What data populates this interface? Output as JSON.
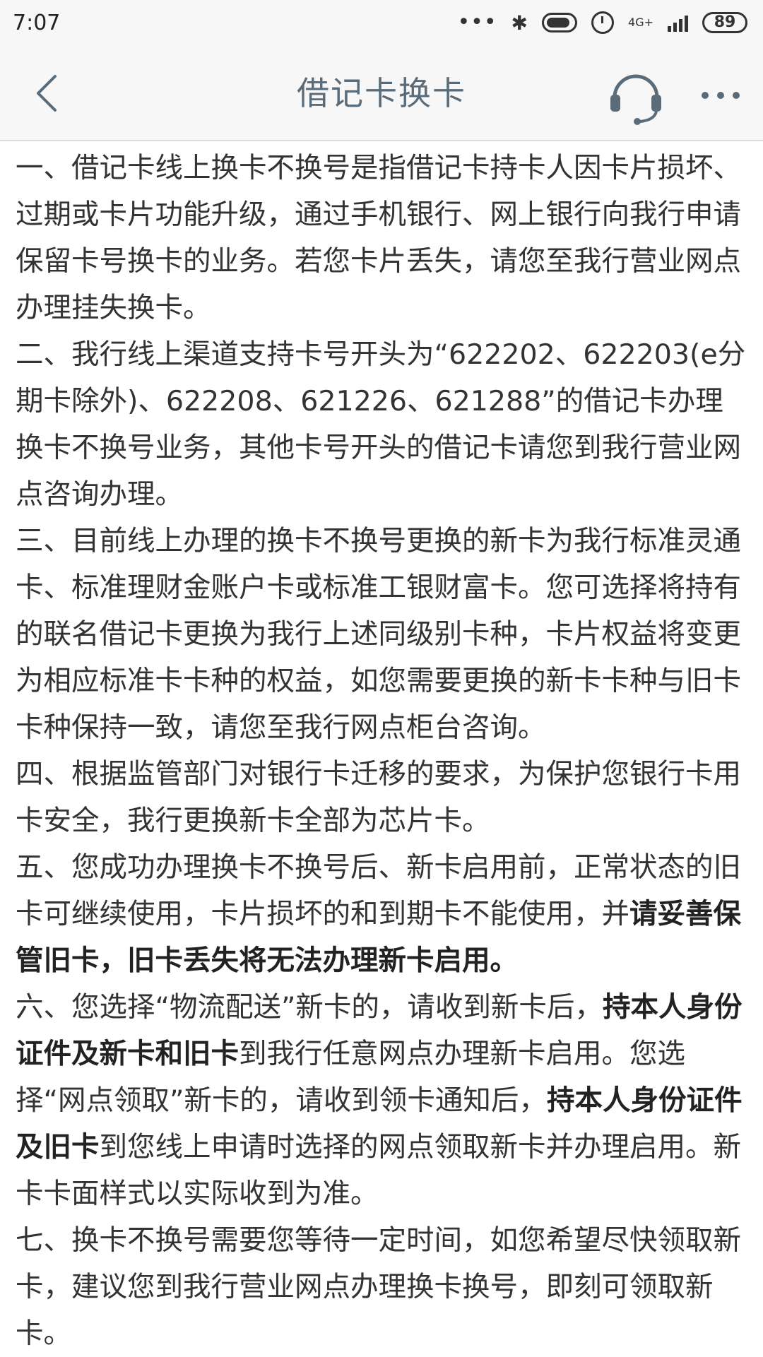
{
  "status_bar": {
    "time": "7:07",
    "dots": "•••",
    "network": "4G+",
    "battery": "89"
  },
  "nav": {
    "title": "借记卡换卡",
    "back_icon": "chevron-left-icon",
    "support_icon": "headset-icon",
    "more_icon": "more-dots-icon",
    "accent_color": "#5a6b79"
  },
  "paragraphs": [
    {
      "segments": [
        {
          "text": "一、借记卡线上换卡不换号是指借记卡持卡人因卡片损坏、过期或卡片功能升级，通过手机银行、网上银行向我行申请保留卡号换卡的业务。若您卡片丢失，请您至我行营业网点办理挂失换卡。",
          "bold": false
        }
      ]
    },
    {
      "segments": [
        {
          "text": "二、我行线上渠道支持卡号开头为“622202、622203(e分期卡除外)、622208、621226、621288”的借记卡办理换卡不换号业务，其他卡号开头的借记卡请您到我行营业网点咨询办理。",
          "bold": false
        }
      ]
    },
    {
      "segments": [
        {
          "text": "三、目前线上办理的换卡不换号更换的新卡为我行标准灵通卡、标准理财金账户卡或标准工银财富卡。您可选择将持有的联名借记卡更换为我行上述同级别卡种，卡片权益将变更为相应标准卡卡种的权益，如您需要更换的新卡卡种与旧卡卡种保持一致，请您至我行网点柜台咨询。",
          "bold": false
        }
      ]
    },
    {
      "segments": [
        {
          "text": "四、根据监管部门对银行卡迁移的要求，为保护您银行卡用卡安全，我行更换新卡全部为芯片卡。",
          "bold": false
        }
      ]
    },
    {
      "segments": [
        {
          "text": "五、您成功办理换卡不换号后、新卡启用前，正常状态的旧卡可继续使用，卡片损坏的和到期卡不能使用，并",
          "bold": false
        },
        {
          "text": "请妥善保管旧卡，旧卡丢失将无法办理新卡启用。",
          "bold": true
        }
      ]
    },
    {
      "segments": [
        {
          "text": "六、您选择“物流配送”新卡的，请收到新卡后，",
          "bold": false
        },
        {
          "text": "持本人身份证件及新卡和旧卡",
          "bold": true
        },
        {
          "text": "到我行任意网点办理新卡启用。您选择“网点领取”新卡的，请收到领卡通知后，",
          "bold": false
        },
        {
          "text": "持本人身份证件及旧卡",
          "bold": true
        },
        {
          "text": "到您线上申请时选择的网点领取新卡并办理启用。新卡卡面样式以实际收到为准。",
          "bold": false
        }
      ]
    },
    {
      "segments": [
        {
          "text": "七、换卡不换号需要您等待一定时间，如您希望尽快领取新卡，建议您到我行营业网点办理换卡换号，即刻可领取新卡。",
          "bold": false
        }
      ]
    }
  ]
}
